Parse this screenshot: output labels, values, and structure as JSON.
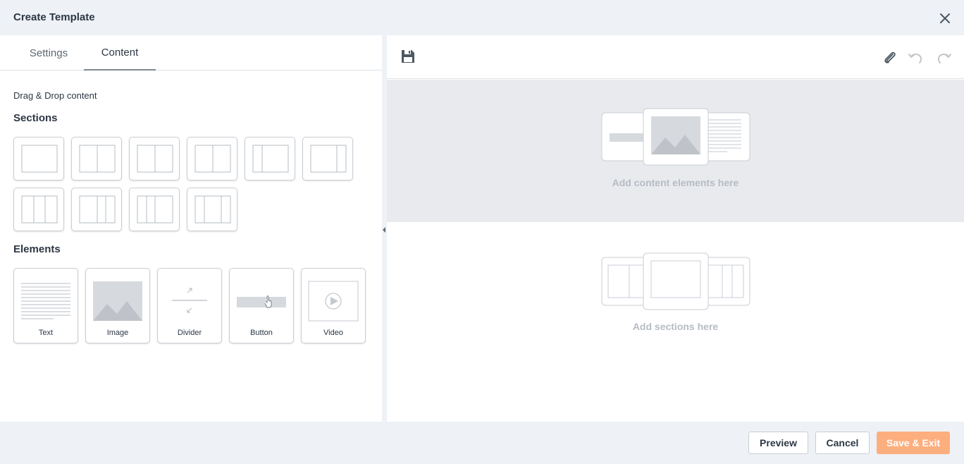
{
  "dialog": {
    "title": "Create Template"
  },
  "tabs": [
    {
      "label": "Settings",
      "active": false
    },
    {
      "label": "Content",
      "active": true
    }
  ],
  "content_panel": {
    "instruction": "Drag & Drop content",
    "sections_heading": "Sections",
    "elements_heading": "Elements",
    "section_layouts": [
      "1 column",
      "2 columns",
      "2 columns",
      "2 columns",
      "1/3 + 2/3",
      "2/3 + 1/3",
      "3 columns",
      "3 columns",
      "3 columns",
      "3 columns"
    ],
    "elements": [
      {
        "label": "Text",
        "icon": "text-lines-icon"
      },
      {
        "label": "Image",
        "icon": "image-icon"
      },
      {
        "label": "Divider",
        "icon": "divider-icon"
      },
      {
        "label": "Button",
        "icon": "button-icon"
      },
      {
        "label": "Video",
        "icon": "video-play-icon"
      }
    ]
  },
  "canvas": {
    "toolbar": {
      "save": "save-icon",
      "attach": "paperclip-icon",
      "undo": "undo-icon",
      "redo": "redo-icon"
    },
    "content_placeholder": "Add content elements here",
    "sections_placeholder": "Add sections here"
  },
  "footer": {
    "preview_label": "Preview",
    "cancel_label": "Cancel",
    "save_exit_label": "Save & Exit"
  },
  "colors": {
    "accent": "#fdae7f",
    "text": "#2c3744",
    "muted": "#b6bcc3"
  }
}
